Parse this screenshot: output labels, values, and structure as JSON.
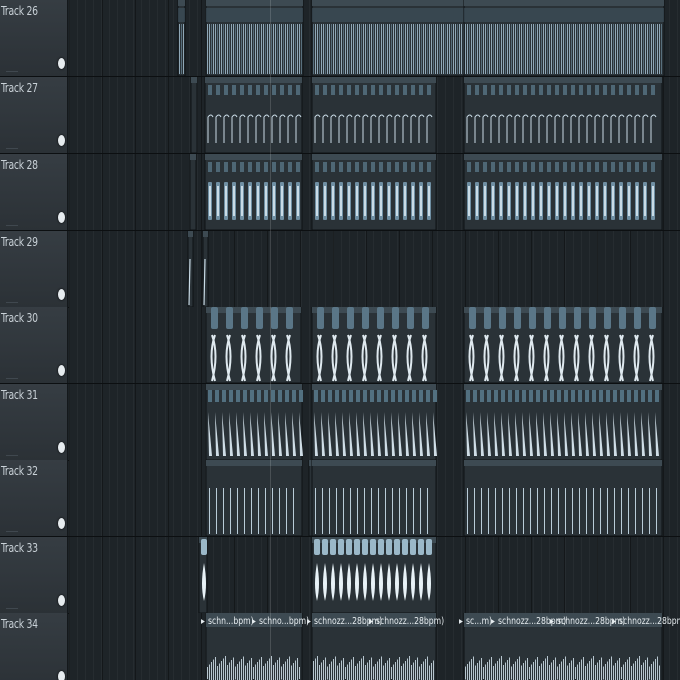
{
  "tracks": [
    {
      "name": "Track 26"
    },
    {
      "name": "Track 27"
    },
    {
      "name": "Track 28"
    },
    {
      "name": "Track 29"
    },
    {
      "name": "Track 30"
    },
    {
      "name": "Track 31"
    },
    {
      "name": "Track 32"
    },
    {
      "name": "Track 33"
    },
    {
      "name": "Track 34"
    }
  ],
  "track34_clips": [
    {
      "title": "schn...bpm)"
    },
    {
      "title": "schno...bpm)"
    },
    {
      "title": "schnozz...28bpm)"
    },
    {
      "title": "schnozz...28bpm)"
    },
    {
      "title": "sc...m)"
    },
    {
      "title": "schnozz...28bpm)"
    },
    {
      "title": "schnozz...28bpm)"
    },
    {
      "title": "schnozz...28bpm)"
    }
  ],
  "colors": {
    "accent": "#8fb0c4",
    "accent_light": "#c9dbe6",
    "clip_bg": "#2a3237",
    "clip_head": "#3d4a52"
  }
}
